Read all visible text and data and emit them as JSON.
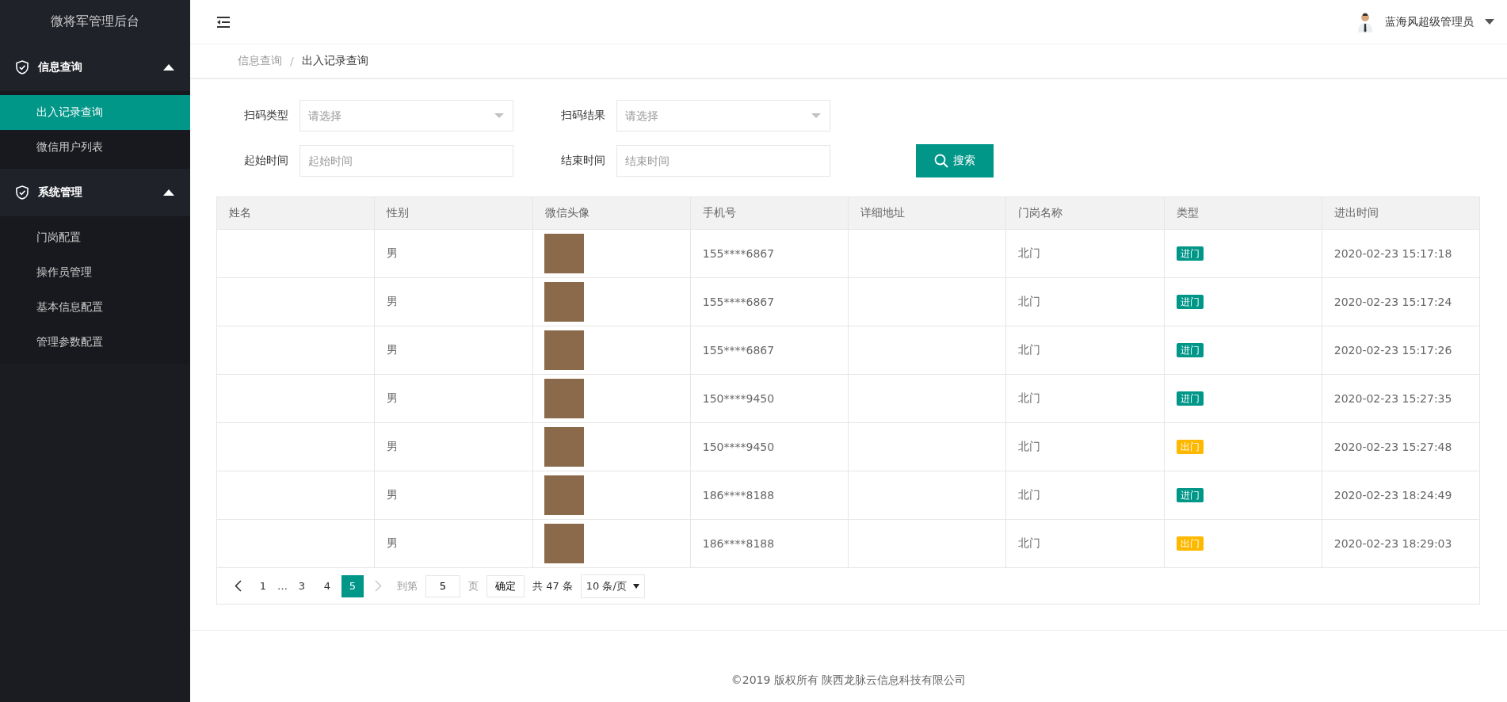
{
  "sidebar": {
    "logo": "微将军管理后台",
    "groups": [
      {
        "label": "信息查询",
        "expanded": true,
        "items": [
          {
            "label": "出入记录查询",
            "selected": true
          },
          {
            "label": "微信用户列表",
            "selected": false
          }
        ]
      },
      {
        "label": "系统管理",
        "expanded": true,
        "items": [
          {
            "label": "门岗配置",
            "selected": false
          },
          {
            "label": "操作员管理",
            "selected": false
          },
          {
            "label": "基本信息配置",
            "selected": false
          },
          {
            "label": "管理参数配置",
            "selected": false
          }
        ]
      }
    ]
  },
  "header": {
    "user": "蓝海风超级管理员"
  },
  "breadcrumb": {
    "separator": "/",
    "items": [
      "信息查询",
      "出入记录查询"
    ]
  },
  "filters": [
    {
      "label": "扫码类型",
      "kind": "select",
      "placeholder": "请选择"
    },
    {
      "label": "扫码结果",
      "kind": "select",
      "placeholder": "请选择"
    },
    {
      "label": "起始时间",
      "kind": "input",
      "placeholder": "起始时间"
    },
    {
      "label": "结束时间",
      "kind": "input",
      "placeholder": "结束时间"
    }
  ],
  "search_button": "搜索",
  "table": {
    "columns": [
      "姓名",
      "性别",
      "微信头像",
      "手机号",
      "详细地址",
      "门岗名称",
      "类型",
      "进出时间"
    ],
    "rows": [
      {
        "gender": "男",
        "phone": "155****6867",
        "gate": "北门",
        "type": {
          "label": "进门",
          "kind": "in"
        },
        "time": "2020-02-23 15:17:18"
      },
      {
        "gender": "男",
        "phone": "155****6867",
        "gate": "北门",
        "type": {
          "label": "进门",
          "kind": "in"
        },
        "time": "2020-02-23 15:17:24"
      },
      {
        "gender": "男",
        "phone": "155****6867",
        "gate": "北门",
        "type": {
          "label": "进门",
          "kind": "in"
        },
        "time": "2020-02-23 15:17:26"
      },
      {
        "gender": "男",
        "phone": "150****9450",
        "gate": "北门",
        "type": {
          "label": "进门",
          "kind": "in"
        },
        "time": "2020-02-23 15:27:35"
      },
      {
        "gender": "男",
        "phone": "150****9450",
        "gate": "北门",
        "type": {
          "label": "出门",
          "kind": "out"
        },
        "time": "2020-02-23 15:27:48"
      },
      {
        "gender": "男",
        "phone": "186****8188",
        "gate": "北门",
        "type": {
          "label": "进门",
          "kind": "in"
        },
        "time": "2020-02-23 18:24:49"
      },
      {
        "gender": "男",
        "phone": "186****8188",
        "gate": "北门",
        "type": {
          "label": "出门",
          "kind": "out"
        },
        "time": "2020-02-23 18:29:03"
      }
    ]
  },
  "pagination": {
    "prev_disabled": false,
    "next_disabled": true,
    "pages": [
      {
        "label": "1",
        "kind": "page",
        "selected": false
      },
      {
        "label": "…",
        "kind": "ellipsis"
      },
      {
        "label": "3",
        "kind": "page",
        "selected": false
      },
      {
        "label": "4",
        "kind": "page",
        "selected": false
      },
      {
        "label": "5",
        "kind": "page",
        "selected": true
      }
    ],
    "goto_label": "到第",
    "goto_value": "5",
    "page_unit": "页",
    "confirm": "确定",
    "total": "共 47 条",
    "page_size": "10 条/页"
  },
  "footer": "©2019 版权所有 陕西龙脉云信息科技有限公司"
}
